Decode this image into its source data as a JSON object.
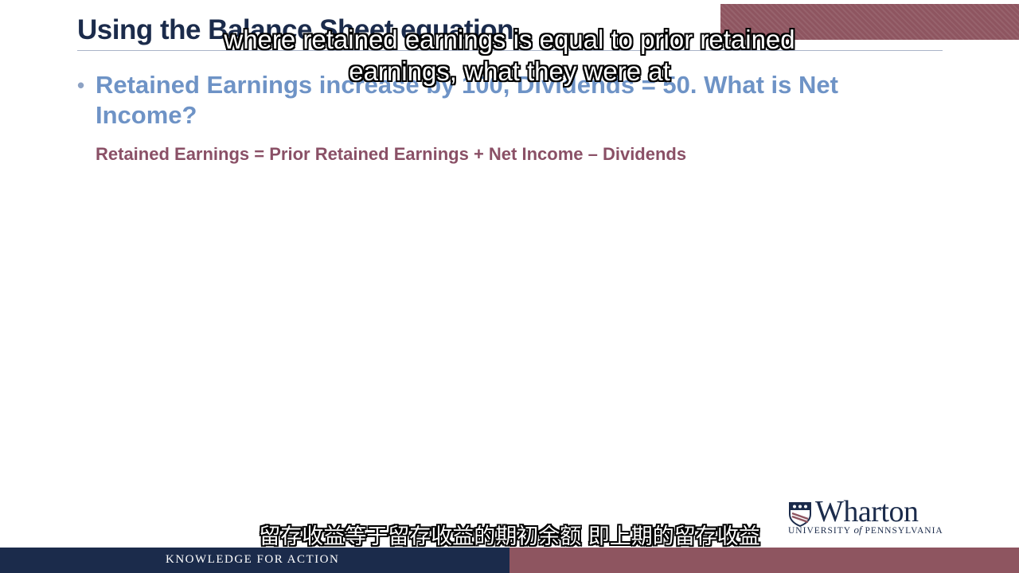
{
  "slide": {
    "title": "Using the Balance Sheet equation",
    "bullet": "Retained Earnings increase by 100, Dividends = 50.  What is Net Income?",
    "formula": "Retained Earnings = Prior Retained Earnings + Net Income – Dividends"
  },
  "captions": {
    "english": "where retained earnings is equal to prior retained earnings, what they were at",
    "chinese": "留存收益等于留存收益的期初余额 即上期的留存收益"
  },
  "branding": {
    "logo_name": "Wharton",
    "logo_subtitle_1": "UNIVERSITY",
    "logo_subtitle_of": "of",
    "logo_subtitle_2": "PENNSYLVANIA",
    "tagline": "KNOWLEDGE FOR ACTION"
  },
  "colors": {
    "navy": "#1b2b4b",
    "maroon": "#8e5560",
    "bullet_blue": "#6e93c6",
    "formula_plum": "#8a5066"
  },
  "icons": {
    "logo_mark": "penn-shield-icon"
  }
}
